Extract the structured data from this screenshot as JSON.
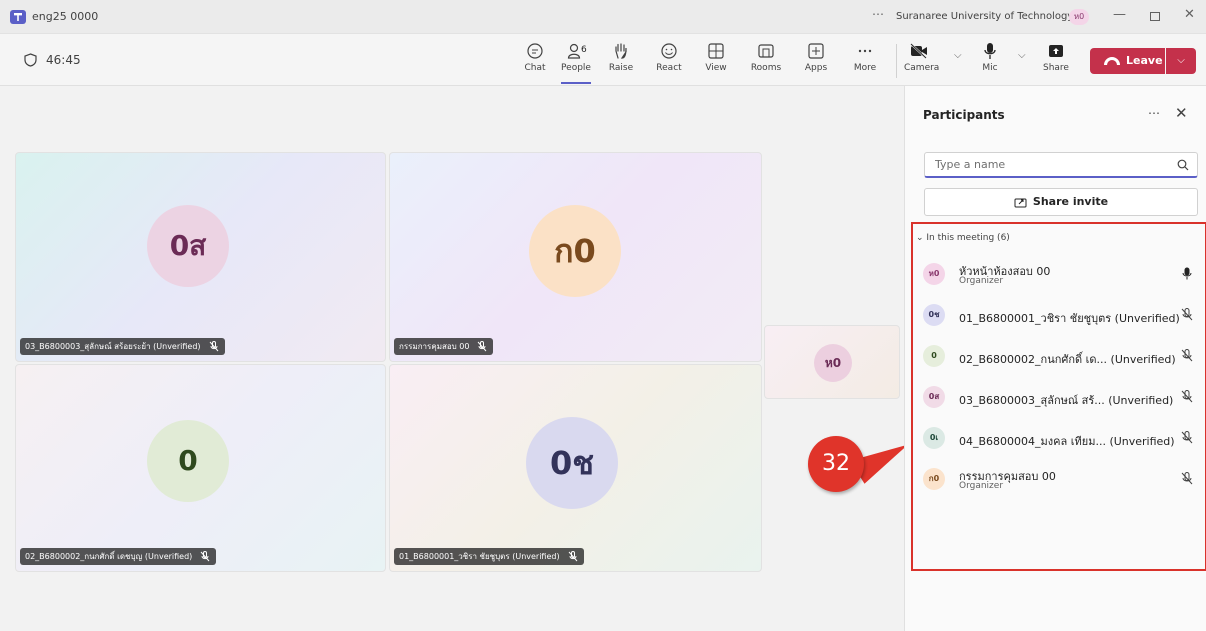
{
  "window": {
    "title": "eng25 0000",
    "org_name": "Suranaree University of Technology",
    "org_avatar": "ห0",
    "more": "⋯"
  },
  "toolbar": {
    "timer": "46:45",
    "people_count": "6",
    "buttons": [
      {
        "label": "Chat",
        "icon": "chat-icon"
      },
      {
        "label": "People",
        "icon": "people-icon",
        "active": true
      },
      {
        "label": "Raise",
        "icon": "raise-hand-icon"
      },
      {
        "label": "React",
        "icon": "react-icon"
      },
      {
        "label": "View",
        "icon": "view-grid-icon"
      },
      {
        "label": "Rooms",
        "icon": "rooms-icon"
      },
      {
        "label": "Apps",
        "icon": "apps-icon"
      },
      {
        "label": "More",
        "icon": "more-icon"
      }
    ],
    "camera_label": "Camera",
    "mic_label": "Mic",
    "share_label": "Share",
    "leave_label": "Leave"
  },
  "tiles": [
    {
      "initials": "0ส",
      "name": "03_B6800003_สุลักษณ์ สร้อยระย้า (Unverified)"
    },
    {
      "initials": "ก0",
      "name": "กรรมการคุมสอบ 00"
    },
    {
      "initials": "0",
      "name": "02_B6800002_กนกศักดิ์ เดชบุญ (Unverified)"
    },
    {
      "initials": "0ช",
      "name": "01_B6800001_วชิรา ชัยชูบุตร (Unverified)"
    },
    {
      "initials": "ห0"
    }
  ],
  "callout": "32",
  "panel": {
    "title": "Participants",
    "more": "⋯",
    "search_placeholder": "Type a name",
    "share_invite": "Share invite",
    "section_label": "In this meeting (6)",
    "participants": [
      {
        "initials": "ห0",
        "name": "หัวหน้าห้องสอบ 00",
        "role": "Organizer"
      },
      {
        "initials": "0ช",
        "name": "01_B6800001_วชิรา ชัยชูบุตร (Unverified)"
      },
      {
        "initials": "0",
        "name": "02_B6800002_กนกศักดิ์ เด... (Unverified)"
      },
      {
        "initials": "0ส",
        "name": "03_B6800003_สุลักษณ์ สร้... (Unverified)"
      },
      {
        "initials": "0เ",
        "name": "04_B6800004_มงคล เทียม... (Unverified)"
      },
      {
        "initials": "ก0",
        "name": "กรรมการคุมสอบ 00",
        "role": "Organizer"
      }
    ]
  },
  "colors": {
    "accent": "#5b5fc7",
    "leave": "#c4314b",
    "callout": "#e0342a"
  }
}
